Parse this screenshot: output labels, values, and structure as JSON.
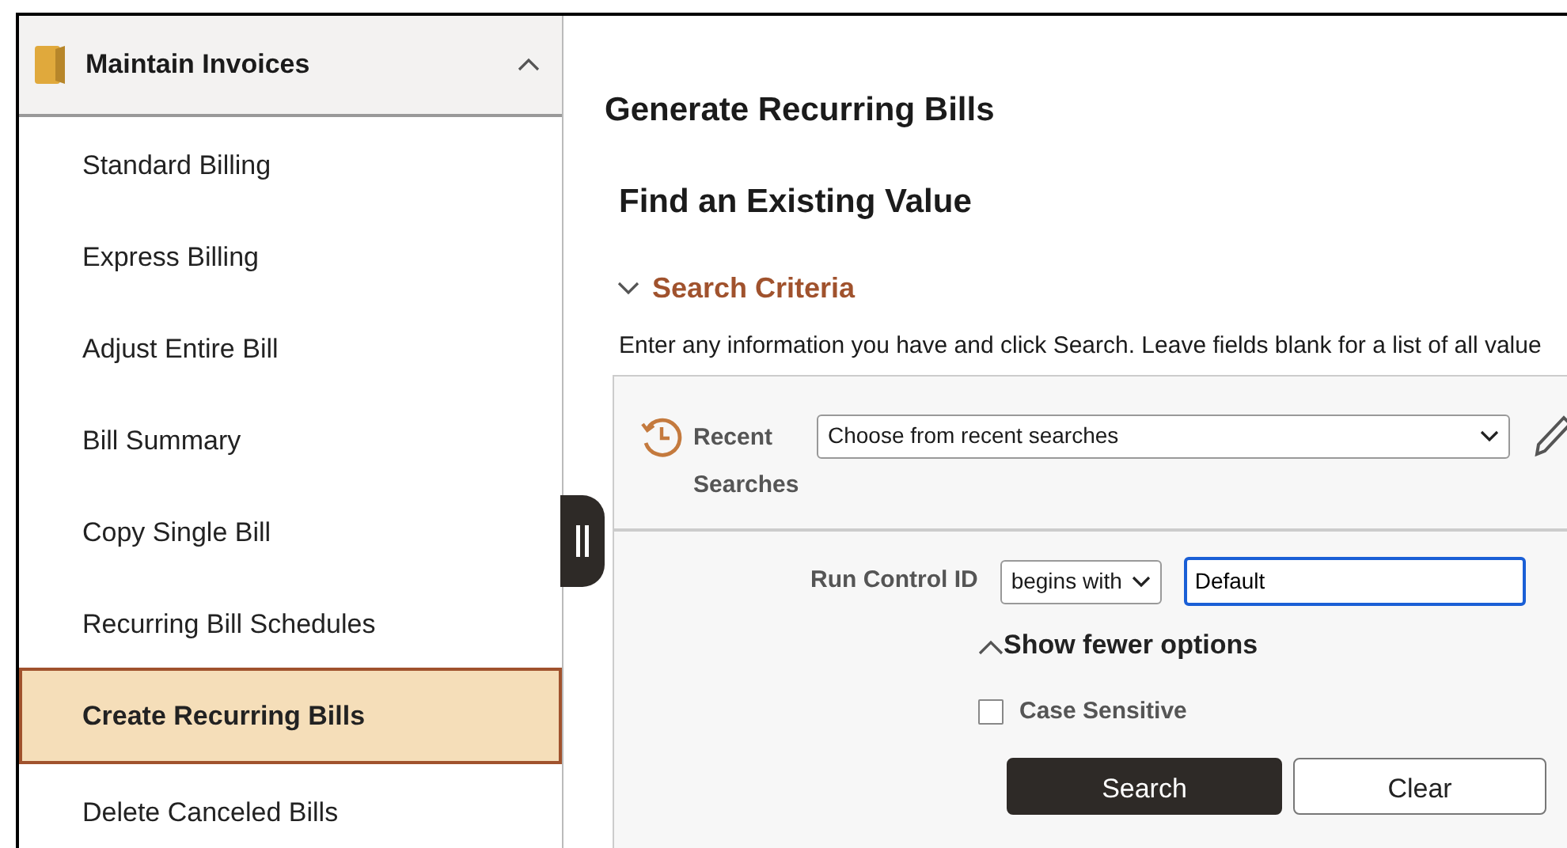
{
  "sidebar": {
    "title": "Maintain Invoices",
    "expanded": true,
    "items": [
      {
        "label": "Standard Billing",
        "selected": false
      },
      {
        "label": "Express Billing",
        "selected": false
      },
      {
        "label": "Adjust Entire Bill",
        "selected": false
      },
      {
        "label": "Bill Summary",
        "selected": false
      },
      {
        "label": "Copy Single Bill",
        "selected": false
      },
      {
        "label": "Recurring Bill Schedules",
        "selected": false
      },
      {
        "label": "Create Recurring Bills",
        "selected": true
      },
      {
        "label": "Delete Canceled Bills",
        "selected": false
      }
    ]
  },
  "page_title": "Generate Recurring Bills",
  "heading": "Find an Existing Value",
  "search_criteria": {
    "title": "Search Criteria",
    "expanded": true,
    "intro": "Enter any information you have and click Search. Leave fields blank for a list of all value",
    "recent_searches": {
      "label_line_1": "Recent",
      "label_line_2": "Searches",
      "value": "Choose from recent searches"
    },
    "run_control_id": {
      "label": "Run Control ID",
      "operator": "begins with",
      "value": "Default"
    },
    "options_toggle": "Show fewer options",
    "case_sensitive": {
      "label": "Case Sensitive",
      "checked": false
    },
    "buttons": [
      "Search",
      "Clear"
    ]
  }
}
